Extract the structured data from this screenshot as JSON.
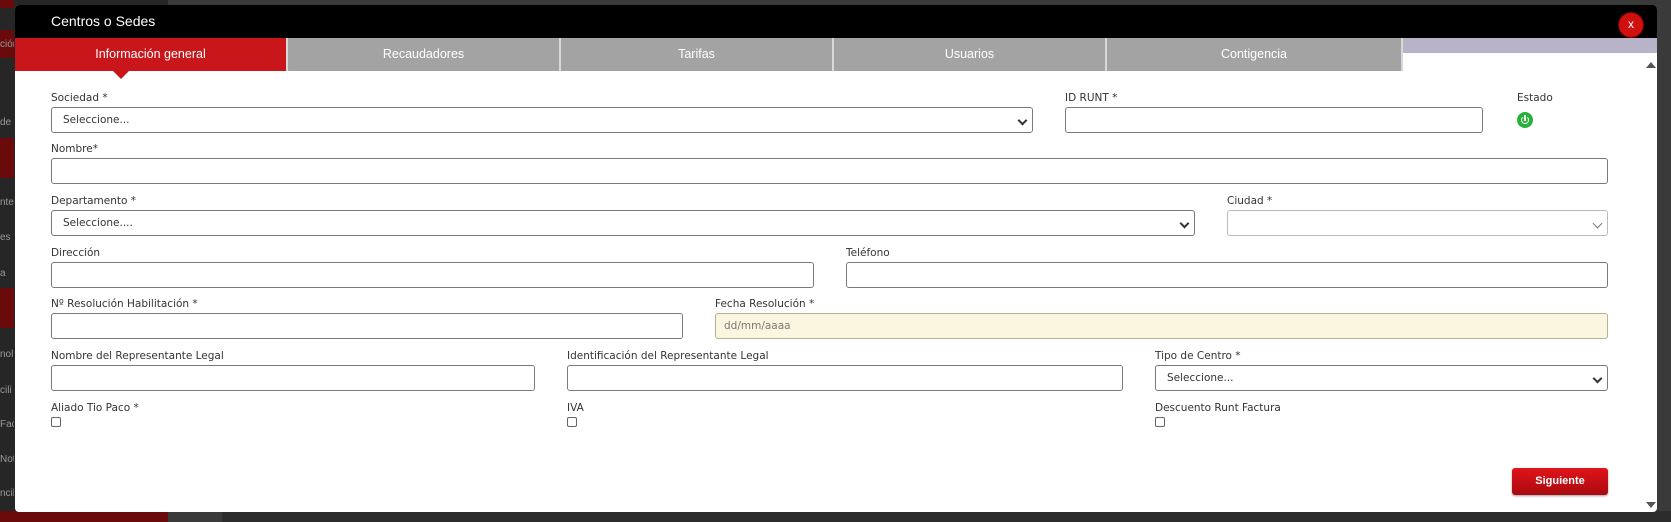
{
  "modal": {
    "title": "Centros o Sedes",
    "close_label": "x"
  },
  "tabs": [
    {
      "label": "Información general",
      "active": true
    },
    {
      "label": "Recaudadores"
    },
    {
      "label": "Tarifas"
    },
    {
      "label": "Usuarios"
    },
    {
      "label": "Contigencia"
    }
  ],
  "form": {
    "sociedad": {
      "label": "Sociedad *",
      "value": "Seleccione..."
    },
    "id_runt": {
      "label": "ID RUNT *",
      "value": ""
    },
    "estado": {
      "label": "Estado",
      "icon": "power-icon",
      "color": "#27b13a"
    },
    "nombre": {
      "label": "Nombre*",
      "value": ""
    },
    "departamento": {
      "label": "Departamento *",
      "value": "Seleccione...."
    },
    "ciudad": {
      "label": "Ciudad *",
      "value": ""
    },
    "direccion": {
      "label": "Dirección",
      "value": ""
    },
    "telefono": {
      "label": "Teléfono",
      "value": ""
    },
    "resolucion": {
      "label": "Nº Resolución Habilitación *",
      "value": ""
    },
    "fecha_resolucion": {
      "label": "Fecha Resolución *",
      "placeholder": "dd/mm/aaaa"
    },
    "representante_nombre": {
      "label": "Nombre del Representante Legal",
      "value": ""
    },
    "representante_id": {
      "label": "Identificación del Representante Legal",
      "value": ""
    },
    "tipo_centro": {
      "label": "Tipo de Centro *",
      "value": "Seleccione..."
    },
    "aliado": {
      "label": "Aliado Tio Paco *",
      "checked": false
    },
    "iva": {
      "label": "IVA",
      "checked": false
    },
    "descuento": {
      "label": "Descuento Runt Factura",
      "checked": false
    }
  },
  "actions": {
    "next_label": "Siguiente"
  },
  "background": {
    "sidebar_fragments": [
      "ción",
      "de",
      "ntes",
      "es",
      "a",
      "nol",
      "cili",
      "Fac",
      "Nota",
      "ncil"
    ]
  },
  "colors": {
    "accent": "#c8161b",
    "tab_inactive": "#a3a3a3",
    "header": "#000000"
  }
}
